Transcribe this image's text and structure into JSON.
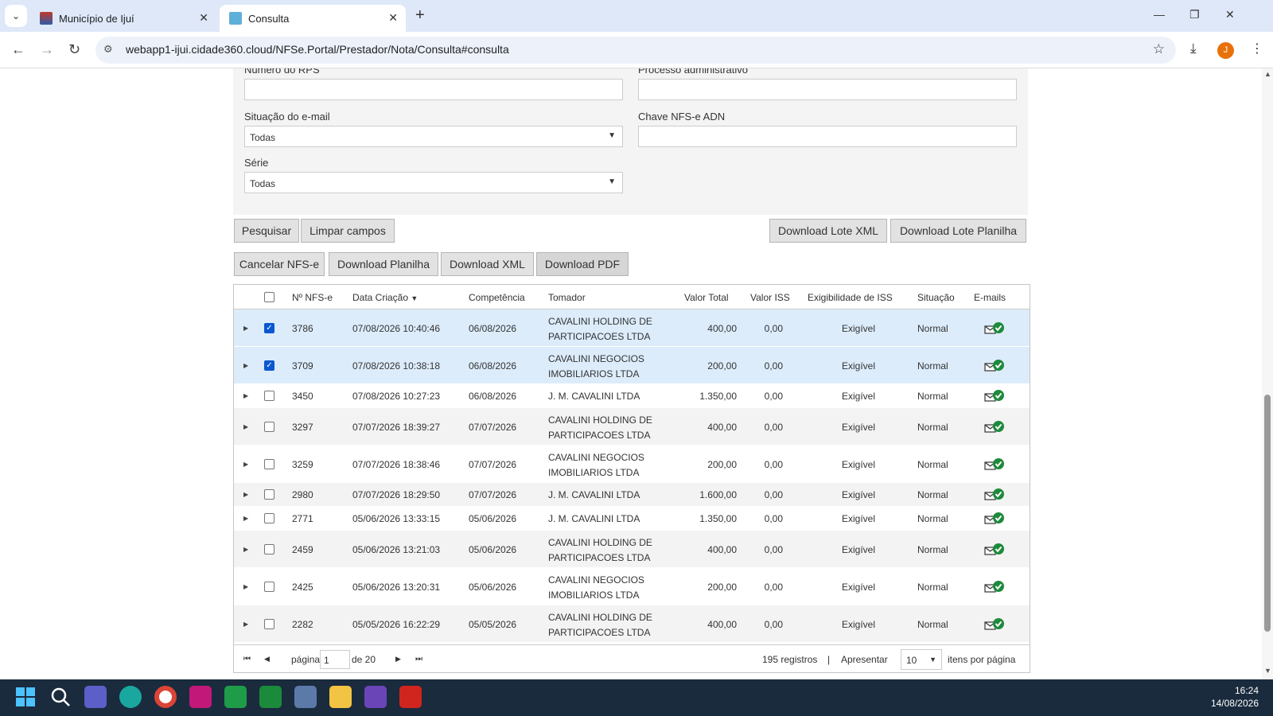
{
  "browser": {
    "tabs": [
      {
        "label": "Município de Ijuí"
      },
      {
        "label": "Consulta"
      }
    ],
    "url": "webapp1-ijui.cidade360.cloud/NFSe.Portal/Prestador/Nota/Consulta#consulta",
    "avatar_letter": "J"
  },
  "form": {
    "rps_label": "Número do RPS",
    "processo_label": "Processo administrativo",
    "email_situation_label": "Situação do e-mail",
    "email_situation_value": "Todas",
    "chave_label": "Chave NFS-e ADN",
    "serie_label": "Série",
    "serie_value": "Todas"
  },
  "buttons": {
    "search": "Pesquisar",
    "clear": "Limpar campos",
    "lote_xml": "Download Lote XML",
    "lote_planilha": "Download Lote Planilha",
    "cancel": "Cancelar NFS-e",
    "dl_planilha": "Download Planilha",
    "dl_xml": "Download XML",
    "dl_pdf": "Download PDF"
  },
  "table": {
    "headers": {
      "nfse": "Nº NFS-e",
      "data": "Data Criação",
      "competencia": "Competência",
      "tomador": "Tomador",
      "valor_total": "Valor Total",
      "valor_iss": "Valor ISS",
      "exig": "Exigibilidade de ISS",
      "situacao": "Situação",
      "emails": "E-mails"
    },
    "rows": [
      {
        "nfse": "3786",
        "data": "07/08/2026 10:40:46",
        "comp": "06/08/2026",
        "tom1": "CAVALINI HOLDING DE",
        "tom2": "PARTICIPACOES LTDA",
        "total": "400,00",
        "iss": "0,00",
        "exig": "Exigível",
        "sit": "Normal",
        "checked": true
      },
      {
        "nfse": "3709",
        "data": "07/08/2026 10:38:18",
        "comp": "06/08/2026",
        "tom1": "CAVALINI NEGOCIOS",
        "tom2": "IMOBILIARIOS LTDA",
        "total": "200,00",
        "iss": "0,00",
        "exig": "Exigível",
        "sit": "Normal",
        "checked": true
      },
      {
        "nfse": "3450",
        "data": "07/08/2026 10:27:23",
        "comp": "06/08/2026",
        "tom1": "J. M. CAVALINI LTDA",
        "tom2": "",
        "total": "1.350,00",
        "iss": "0,00",
        "exig": "Exigível",
        "sit": "Normal",
        "checked": false
      },
      {
        "nfse": "3297",
        "data": "07/07/2026 18:39:27",
        "comp": "07/07/2026",
        "tom1": "CAVALINI HOLDING DE",
        "tom2": "PARTICIPACOES LTDA",
        "total": "400,00",
        "iss": "0,00",
        "exig": "Exigível",
        "sit": "Normal",
        "checked": false
      },
      {
        "nfse": "3259",
        "data": "07/07/2026 18:38:46",
        "comp": "07/07/2026",
        "tom1": "CAVALINI NEGOCIOS",
        "tom2": "IMOBILIARIOS LTDA",
        "total": "200,00",
        "iss": "0,00",
        "exig": "Exigível",
        "sit": "Normal",
        "checked": false
      },
      {
        "nfse": "2980",
        "data": "07/07/2026 18:29:50",
        "comp": "07/07/2026",
        "tom1": "J. M. CAVALINI LTDA",
        "tom2": "",
        "total": "1.600,00",
        "iss": "0,00",
        "exig": "Exigível",
        "sit": "Normal",
        "checked": false
      },
      {
        "nfse": "2771",
        "data": "05/06/2026 13:33:15",
        "comp": "05/06/2026",
        "tom1": "J. M. CAVALINI LTDA",
        "tom2": "",
        "total": "1.350,00",
        "iss": "0,00",
        "exig": "Exigível",
        "sit": "Normal",
        "checked": false
      },
      {
        "nfse": "2459",
        "data": "05/06/2026 13:21:03",
        "comp": "05/06/2026",
        "tom1": "CAVALINI HOLDING DE",
        "tom2": "PARTICIPACOES LTDA",
        "total": "400,00",
        "iss": "0,00",
        "exig": "Exigível",
        "sit": "Normal",
        "checked": false
      },
      {
        "nfse": "2425",
        "data": "05/06/2026 13:20:31",
        "comp": "05/06/2026",
        "tom1": "CAVALINI NEGOCIOS",
        "tom2": "IMOBILIARIOS LTDA",
        "total": "200,00",
        "iss": "0,00",
        "exig": "Exigível",
        "sit": "Normal",
        "checked": false
      },
      {
        "nfse": "2282",
        "data": "05/05/2026 16:22:29",
        "comp": "05/05/2026",
        "tom1": "CAVALINI HOLDING DE",
        "tom2": "PARTICIPACOES LTDA",
        "total": "400,00",
        "iss": "0,00",
        "exig": "Exigível",
        "sit": "Normal",
        "checked": false
      }
    ]
  },
  "pager": {
    "page_label": "página",
    "page_value": "1",
    "of_label": "de 20",
    "records": "195 registros",
    "separator": "|",
    "show_label": "Apresentar",
    "page_size": "10",
    "per_page_label": "itens por página"
  },
  "taskbar": {
    "time": "16:24",
    "date": "14/08/2026"
  },
  "colors": {
    "selected_row": "#dcecfb",
    "alt_row": "#f3f3f3",
    "mail_ok": "#1e8a3c",
    "taskbar": "#1a2b3e"
  }
}
